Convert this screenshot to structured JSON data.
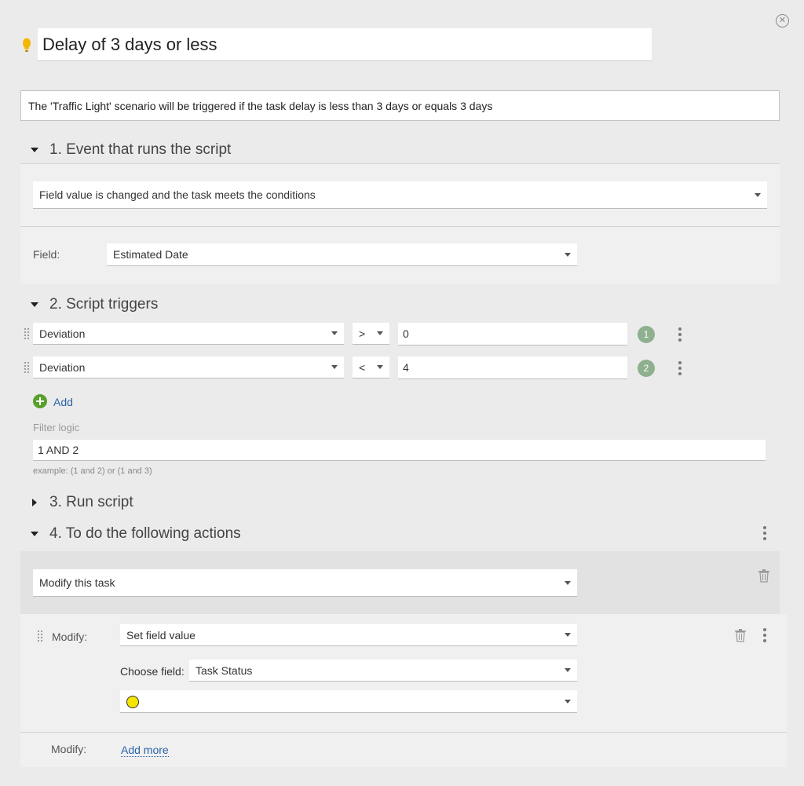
{
  "header": {
    "title": "Delay of 3 days or less",
    "description": "The 'Traffic Light' scenario will be triggered if the task delay is less than 3 days or equals 3 days",
    "close_glyph": "✕"
  },
  "section1": {
    "heading": "1. Event that runs the script",
    "event_value": "Field value is changed and the task meets the conditions",
    "field_label": "Field:",
    "field_value": "Estimated Date"
  },
  "section2": {
    "heading": "2. Script triggers",
    "conditions": [
      {
        "field": "Deviation",
        "operator": ">",
        "value": "0",
        "index": "1"
      },
      {
        "field": "Deviation",
        "operator": "<",
        "value": "4",
        "index": "2"
      }
    ],
    "add_label": "Add",
    "filter_logic_label": "Filter logic",
    "filter_logic_value": "1 AND 2",
    "example_text": "example: (1 and 2) or (1 and 3)"
  },
  "section3": {
    "heading": "3. Run script"
  },
  "section4": {
    "heading": "4. To do the following actions",
    "action_value": "Modify this task",
    "modify_label": "Modify:",
    "modify_value": "Set field value",
    "choose_field_label": "Choose field:",
    "choose_field_value": "Task Status",
    "status_color": "#f5e600",
    "add_more_label": "Modify:",
    "add_more_link": "Add more"
  },
  "colors": {
    "background": "#ebebeb",
    "badge": "#8fb08f",
    "add_green": "#5aa02c",
    "link": "#2a63a8",
    "bulb": "#f3b600"
  }
}
